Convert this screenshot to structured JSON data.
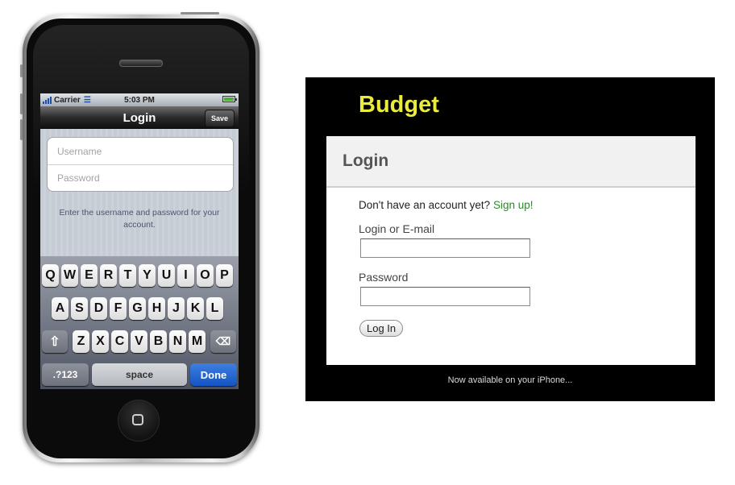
{
  "phone": {
    "status": {
      "carrier": "Carrier",
      "time": "5:03 PM"
    },
    "nav": {
      "title": "Login",
      "save_label": "Save"
    },
    "form": {
      "username_placeholder": "Username",
      "password_placeholder": "Password",
      "hint": "Enter the username and password for your account."
    },
    "keyboard": {
      "row1": [
        "Q",
        "W",
        "E",
        "R",
        "T",
        "Y",
        "U",
        "I",
        "O",
        "P"
      ],
      "row2": [
        "A",
        "S",
        "D",
        "F",
        "G",
        "H",
        "J",
        "K",
        "L"
      ],
      "row3": [
        "Z",
        "X",
        "C",
        "V",
        "B",
        "N",
        "M"
      ],
      "numbers_label": ".?123",
      "space_label": "space",
      "done_label": "Done"
    }
  },
  "web": {
    "logo": "Budget",
    "heading": "Login",
    "signup_prompt": "Don't have an account yet?",
    "signup_link": "Sign up!",
    "login_label": "Login or E-mail",
    "password_label": "Password",
    "login_button": "Log In",
    "footer": "Now available on your iPhone..."
  },
  "colors": {
    "logo": "#e9ec3f",
    "signup_link": "#2a8a2a",
    "done_key": "#1f66d6",
    "battery": "#4db02f"
  }
}
